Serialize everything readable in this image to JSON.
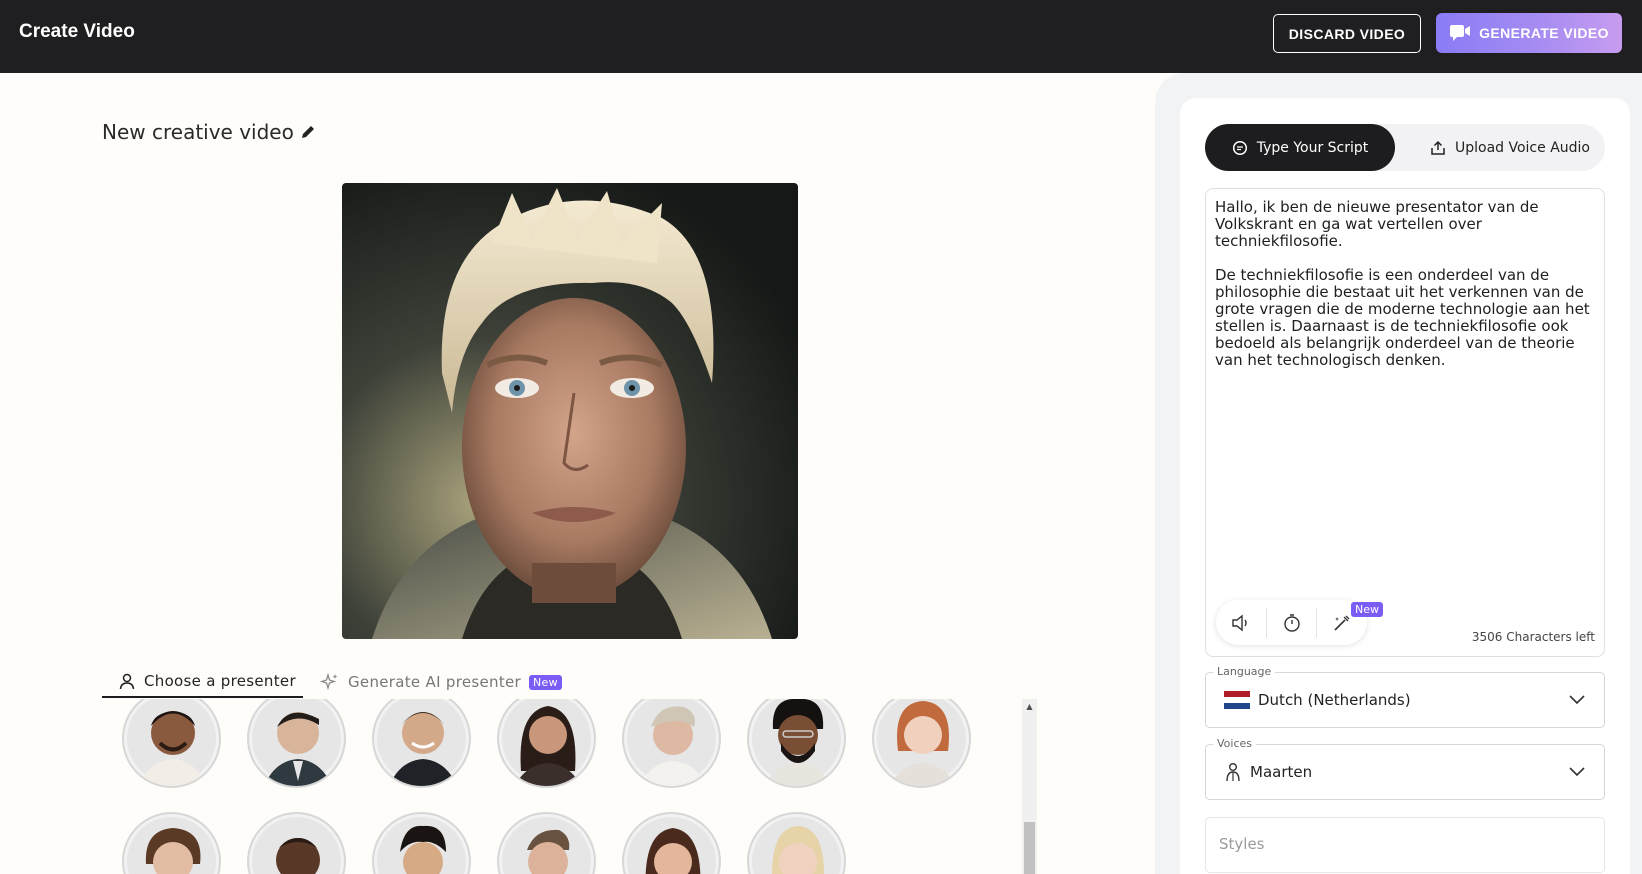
{
  "header": {
    "title": "Create Video",
    "discard_label": "DISCARD VIDEO",
    "generate_label": "GENERATE VIDEO",
    "accent_gradient": [
      "#8a7cf6",
      "#c79cf0"
    ]
  },
  "editor": {
    "video_title": "New creative video",
    "tabs": [
      {
        "label": "Choose a presenter",
        "icon": "person-icon",
        "active": true
      },
      {
        "label": "Generate AI presenter",
        "icon": "sparkles-icon",
        "badge": "New",
        "active": false
      }
    ],
    "presenters_count": 13
  },
  "script_panel": {
    "tabs": [
      {
        "label": "Type Your Script",
        "icon": "chat-bubble-icon",
        "active": true
      },
      {
        "label": "Upload Voice Audio",
        "icon": "upload-icon",
        "active": false
      }
    ],
    "script_text": "Hallo, ik ben de nieuwe presentator van de Volkskrant en ga wat vertellen over techniekfilosofie.\n\nDe techniekfilosofie is een onderdeel van de philosophie die bestaat uit het verkennen van de grote vragen die de moderne technologie aan het stellen is. Daarnaast is de techniekfilosofie ook bedoeld als belangrijk onderdeel van de theorie van het technologisch denken.",
    "tools": [
      "speaker-icon",
      "timer-icon",
      "magic-wand-icon"
    ],
    "tools_badge": "New",
    "chars_left": "3506 Characters left",
    "language": {
      "label": "Language",
      "flag": "nl-flag-icon",
      "value": "Dutch (Netherlands)"
    },
    "voice": {
      "label": "Voices",
      "icon": "person-voice-icon",
      "value": "Maarten"
    },
    "styles": {
      "placeholder": "Styles"
    }
  }
}
